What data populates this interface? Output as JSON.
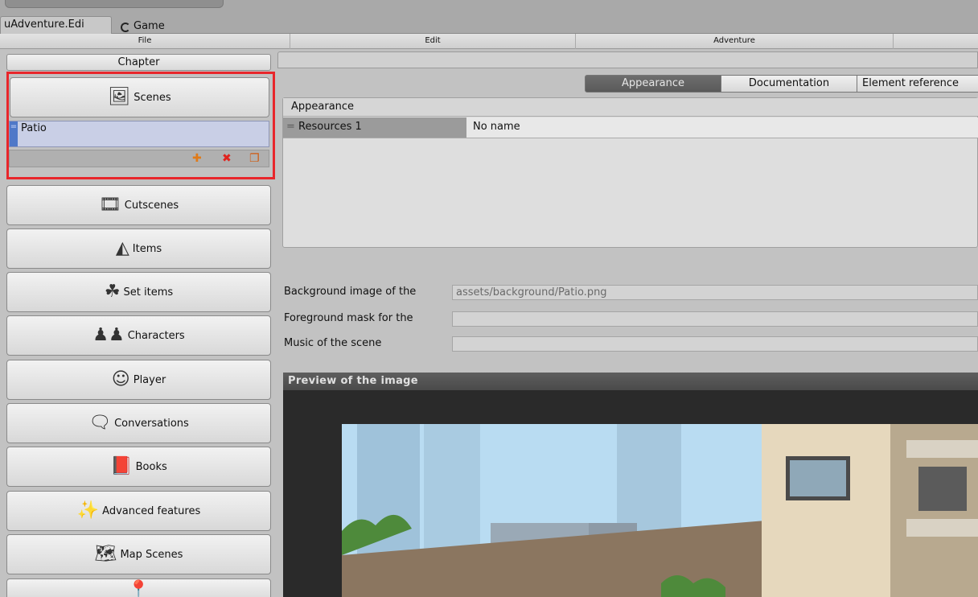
{
  "window_tabs": {
    "editor": "uAdventure.Edi",
    "game": "Game"
  },
  "menubar": {
    "file": "File",
    "edit": "Edit",
    "adventure": "Adventure"
  },
  "sidebar": {
    "chapter": "Chapter",
    "scenes": {
      "label": "Scenes",
      "items": [
        "Patio"
      ]
    },
    "buttons": {
      "cutscenes": "Cutscenes",
      "items": "Items",
      "set_items": "Set items",
      "characters": "Characters",
      "player": "Player",
      "conversations": "Conversations",
      "books": "Books",
      "advanced": "Advanced features",
      "map_scenes": "Map Scenes"
    }
  },
  "main": {
    "tabs": {
      "appearance": "Appearance",
      "documentation": "Documentation",
      "element_reference": "Element reference"
    },
    "appearance_header": "Appearance",
    "resources_row": {
      "label": "Resources 1",
      "name": "No name"
    },
    "properties": {
      "background_label": "Background image of the",
      "background_value": "assets/background/Patio.png",
      "foreground_label": "Foreground mask for the",
      "foreground_value": "",
      "music_label": "Music of the scene",
      "music_value": ""
    },
    "preview_title": "Preview of the image"
  },
  "colors": {
    "highlight": "#e8262b",
    "selected_row": "#c9cfe6",
    "active_tab": "#5a5a5a"
  }
}
